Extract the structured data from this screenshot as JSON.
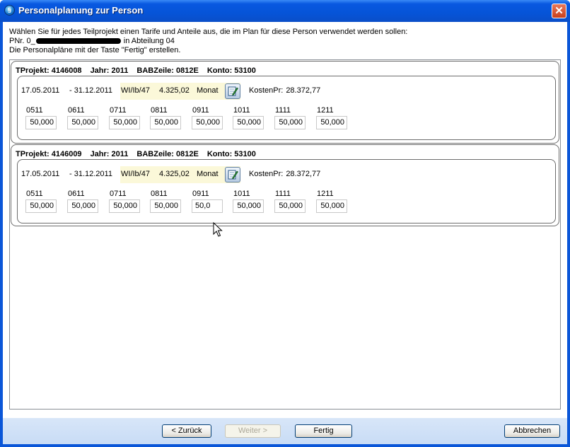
{
  "window": {
    "title": "Personalplanung zur Person",
    "close_label": "✕"
  },
  "intro": {
    "line1": "Wählen Sie für jedes Teilprojekt einen Tarife und Anteile aus, die im Plan für diese Person verwendet werden sollen:",
    "line2_prefix": "PNr. 0_",
    "line2_suffix": "in Abteilung 04",
    "line3": "Die Personalpläne mit der Taste \"Fertig\" erstellen."
  },
  "projects": [
    {
      "tprojekt": "TProjekt: 4146008",
      "jahr": "Jahr: 2011",
      "babzeile": "BABZeile: 0812E",
      "konto": "Konto: 53100",
      "date_from": "17.05.2011",
      "date_to": "- 31.12.2011",
      "tarif": "WI/Ib/47",
      "betrag": "4.325,02",
      "unit": "Monat",
      "kosten_label": "KostenPr:",
      "kosten_value": "28.372,77",
      "months": [
        {
          "label": "0511",
          "value": "50,000"
        },
        {
          "label": "0611",
          "value": "50,000"
        },
        {
          "label": "0711",
          "value": "50,000"
        },
        {
          "label": "0811",
          "value": "50,000"
        },
        {
          "label": "0911",
          "value": "50,000"
        },
        {
          "label": "1011",
          "value": "50,000"
        },
        {
          "label": "1111",
          "value": "50,000"
        },
        {
          "label": "1211",
          "value": "50,000"
        }
      ]
    },
    {
      "tprojekt": "TProjekt: 4146009",
      "jahr": "Jahr: 2011",
      "babzeile": "BABZeile: 0812E",
      "konto": "Konto: 53100",
      "date_from": "17.05.2011",
      "date_to": "- 31.12.2011",
      "tarif": "WI/Ib/47",
      "betrag": "4.325,02",
      "unit": "Monat",
      "kosten_label": "KostenPr:",
      "kosten_value": "28.372,77",
      "months": [
        {
          "label": "0511",
          "value": "50,000"
        },
        {
          "label": "0611",
          "value": "50,000"
        },
        {
          "label": "0711",
          "value": "50,000"
        },
        {
          "label": "0811",
          "value": "50,000"
        },
        {
          "label": "0911",
          "value": "50,0"
        },
        {
          "label": "1011",
          "value": "50,000"
        },
        {
          "label": "1111",
          "value": "50,000"
        },
        {
          "label": "1211",
          "value": "50,000"
        }
      ]
    }
  ],
  "buttons": {
    "back": "< Zurück",
    "next": "Weiter >",
    "finish": "Fertig",
    "cancel": "Abbrechen"
  },
  "colors": {
    "titlebar": "#0858e0",
    "tarif_highlight": "#fbf8d9",
    "close_button": "#c8401c"
  },
  "icons": {
    "app": "app-globe-icon",
    "edit": "edit-notepad-icon",
    "cursor": "mouse-pointer-icon"
  }
}
